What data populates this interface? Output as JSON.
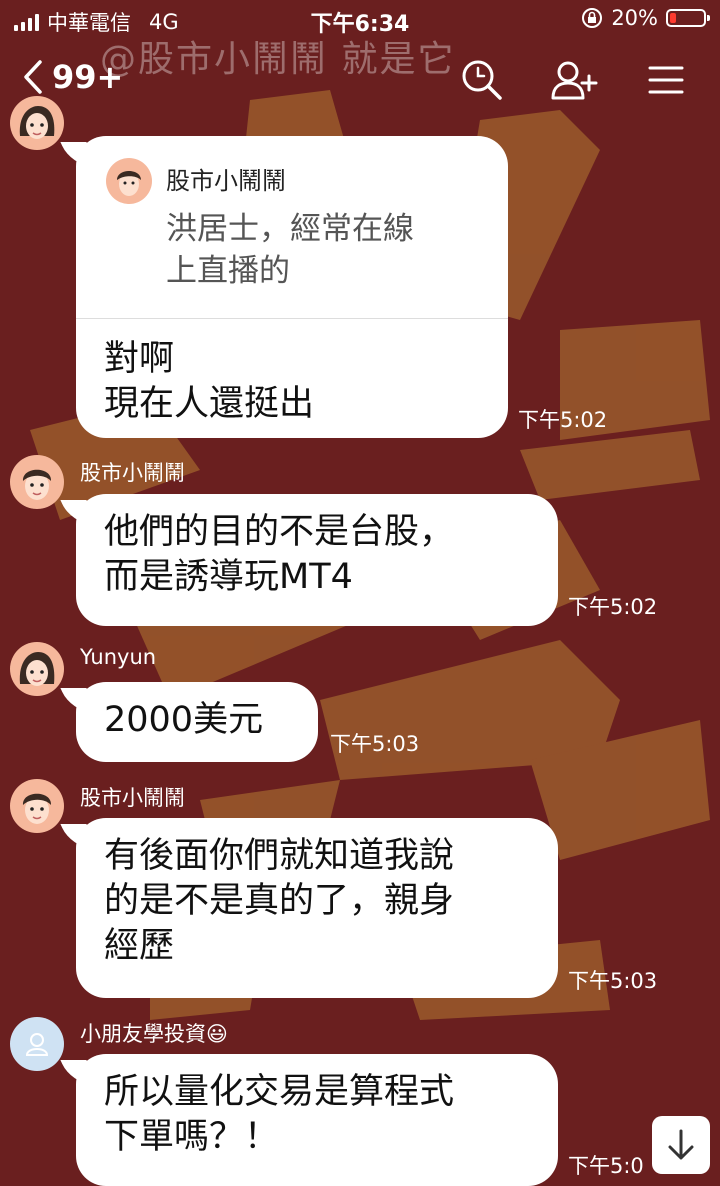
{
  "status_bar": {
    "carrier": "中華電信",
    "network": "4G",
    "time": "下午6:34",
    "battery": "20%",
    "battery_level": 0.2
  },
  "nav": {
    "back_count": "99+",
    "room_name_ghost": "@股市小鬧鬧 就是它",
    "icons": [
      "search-icon",
      "add-friend-icon",
      "menu-icon"
    ]
  },
  "messages": [
    {
      "sender": "Yunyun",
      "quote": {
        "name": "股市小鬧鬧",
        "text_line1": "洪居士，經常在線",
        "text_line2": "上直播的"
      },
      "line1": "對啊",
      "line2": "現在人還挺出",
      "time": "下午5:02"
    },
    {
      "sender": "股市小鬧鬧",
      "line1": "他們的目的不是台股，",
      "line2": "而是誘導玩MT4",
      "time": "下午5:02"
    },
    {
      "sender": "Yunyun",
      "line1": "2000美元",
      "time": "下午5:03"
    },
    {
      "sender": "股市小鬧鬧",
      "line1": "有後面你們就知道我說",
      "line2": "的是不是真的了，親身",
      "line3": "經歷",
      "time": "下午5:03"
    },
    {
      "sender": "小朋友學投資",
      "sender_emoji": "😃",
      "line1": "所以量化交易是算程式",
      "line2": "下單嗎？！",
      "time": "下午5:0"
    }
  ],
  "colors": {
    "background": "#6a1f1f",
    "art": "#9a5a2c",
    "bubble": "#ffffff",
    "battery_low": "#ff3b30"
  }
}
